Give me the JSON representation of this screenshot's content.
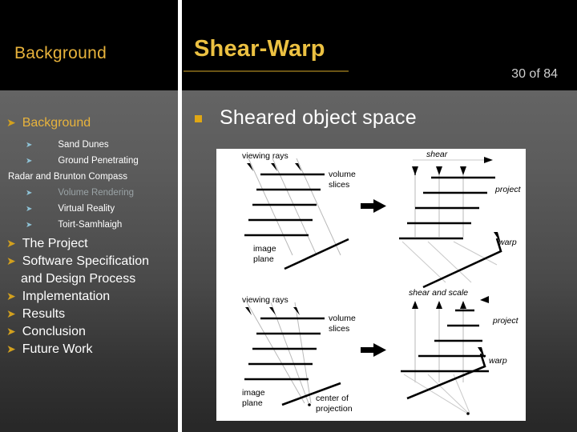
{
  "header": {
    "section_label": "Background",
    "title": "Shear-Warp",
    "slide_number": "30 of 84"
  },
  "sidebar": {
    "items": [
      {
        "label": "Background",
        "level": 1,
        "state": "current"
      },
      {
        "label": "Sand Dunes",
        "level": 2,
        "state": "normal"
      },
      {
        "label": "Ground Penetrating",
        "level": 2,
        "state": "normal"
      },
      {
        "label": "Radar  and Brunton Compass",
        "level": 2,
        "state": "normal",
        "continuation": true
      },
      {
        "label": "Volume Rendering",
        "level": 2,
        "state": "visited"
      },
      {
        "label": "Virtual Reality",
        "level": 2,
        "state": "normal"
      },
      {
        "label": "Toirt-Samhlaigh",
        "level": 2,
        "state": "normal"
      },
      {
        "label": "The Project",
        "level": 1,
        "state": "normal"
      },
      {
        "label": "Software Specification",
        "level": 1,
        "state": "normal"
      },
      {
        "label": "and Design Process",
        "level": 1,
        "state": "normal",
        "continuation": true
      },
      {
        "label": "Implementation",
        "level": 1,
        "state": "normal"
      },
      {
        "label": "Results",
        "level": 1,
        "state": "normal"
      },
      {
        "label": "Conclusion",
        "level": 1,
        "state": "normal"
      },
      {
        "label": "Future Work",
        "level": 1,
        "state": "normal"
      }
    ]
  },
  "main": {
    "heading": "Sheared object space",
    "figure": {
      "panels": [
        {
          "id": "parallel-before",
          "labels": [
            "viewing rays",
            "volume slices",
            "image plane"
          ]
        },
        {
          "id": "parallel-after",
          "labels": [
            "shear",
            "project",
            "warp"
          ]
        },
        {
          "id": "perspective-before",
          "labels": [
            "viewing rays",
            "volume slices",
            "image plane",
            "center of projection"
          ]
        },
        {
          "id": "perspective-after",
          "labels": [
            "shear and scale",
            "project",
            "warp"
          ]
        }
      ]
    }
  },
  "colors": {
    "accent_gold": "#e8b33c",
    "title_gold": "#ecc142",
    "bullet_orange": "#e0a714",
    "sub_arrow_blue": "#8fc4d8",
    "visited_gray": "#9aa3a6",
    "header_black": "#000000",
    "divider_white": "#ffffff"
  }
}
